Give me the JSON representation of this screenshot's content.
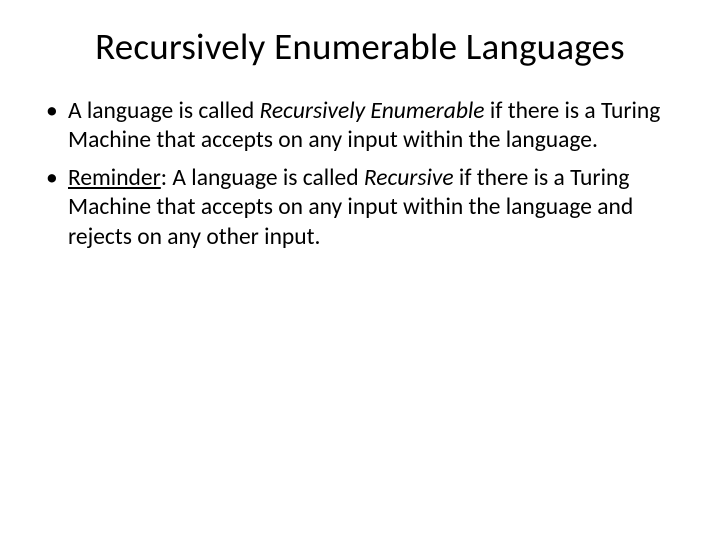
{
  "title": "Recursively Enumerable Languages",
  "bullets": [
    {
      "prefix": "A language is called ",
      "em1": "Recursively Enumerable",
      "mid": " if there is a Turing Machine that accepts on any input within the language.",
      "u": "",
      "aftU": "",
      "em2": "",
      "tail": ""
    },
    {
      "prefix": "",
      "u": "Reminder",
      "aftU": ": A language is called ",
      "em1": "",
      "mid": "",
      "em2": "Recursive",
      "tail": " if there is a Turing Machine that accepts on any input within the language and rejects on any other input."
    }
  ]
}
